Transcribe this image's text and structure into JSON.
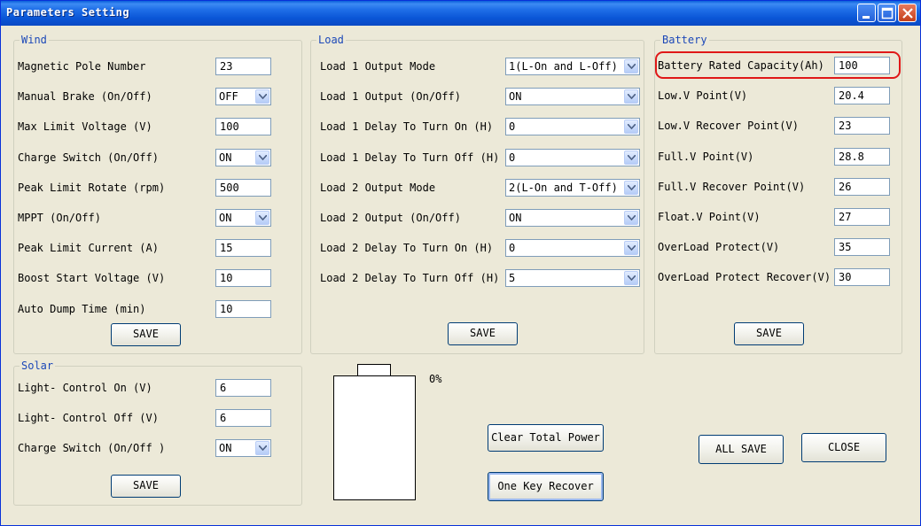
{
  "window": {
    "title": "Parameters Setting"
  },
  "wind": {
    "title": "Wind",
    "fields": [
      {
        "label": "Magnetic Pole Number",
        "value": "23",
        "type": "input"
      },
      {
        "label": "Manual Brake (On/Off)",
        "value": "OFF",
        "type": "select"
      },
      {
        "label": "Max Limit Voltage (V)",
        "value": "100",
        "type": "input"
      },
      {
        "label": "Charge Switch (On/Off)",
        "value": "ON",
        "type": "select"
      },
      {
        "label": "Peak Limit Rotate (rpm)",
        "value": "500",
        "type": "input"
      },
      {
        "label": "MPPT (On/Off)",
        "value": "ON",
        "type": "select"
      },
      {
        "label": "Peak Limit Current (A)",
        "value": "15",
        "type": "input"
      },
      {
        "label": "Boost Start Voltage (V)",
        "value": "10",
        "type": "input"
      },
      {
        "label": "Auto Dump Time (min)",
        "value": "10",
        "type": "input"
      }
    ],
    "save_label": "SAVE"
  },
  "load": {
    "title": "Load",
    "fields": [
      {
        "label": "Load 1 Output Mode",
        "value": "1(L-On and L-Off)"
      },
      {
        "label": "Load 1 Output (On/Off)",
        "value": "ON"
      },
      {
        "label": "Load 1 Delay To Turn On (H)",
        "value": "0"
      },
      {
        "label": "Load 1 Delay To Turn Off (H)",
        "value": "0"
      },
      {
        "label": "Load 2 Output Mode",
        "value": "2(L-On and T-Off)"
      },
      {
        "label": "Load 2 Output (On/Off)",
        "value": "ON"
      },
      {
        "label": "Load 2 Delay To Turn On (H)",
        "value": "0"
      },
      {
        "label": "Load 2 Delay To Turn Off (H)",
        "value": "5"
      }
    ],
    "save_label": "SAVE"
  },
  "battery": {
    "title": "Battery",
    "fields": [
      {
        "label": "Battery Rated Capacity(Ah)",
        "value": "100"
      },
      {
        "label": "Low.V Point(V)",
        "value": "20.4"
      },
      {
        "label": "Low.V Recover Point(V)",
        "value": "23"
      },
      {
        "label": "Full.V Point(V)",
        "value": "28.8"
      },
      {
        "label": "Full.V Recover Point(V)",
        "value": "26"
      },
      {
        "label": "Float.V Point(V)",
        "value": "27"
      },
      {
        "label": "OverLoad Protect(V)",
        "value": "35"
      },
      {
        "label": "OverLoad Protect Recover(V)",
        "value": "30"
      }
    ],
    "save_label": "SAVE"
  },
  "solar": {
    "title": "Solar",
    "fields": [
      {
        "label": "Light- Control On (V)",
        "value": "6",
        "type": "input"
      },
      {
        "label": "Light- Control Off (V)",
        "value": "6",
        "type": "input"
      },
      {
        "label": "Charge Switch (On/Off )",
        "value": "ON",
        "type": "select"
      }
    ],
    "save_label": "SAVE"
  },
  "battery_indicator": {
    "percent_label": "0%",
    "level": 0
  },
  "actions": {
    "clear_total_power": "Clear Total Power",
    "one_key_recover": "One Key Recover",
    "all_save": "ALL SAVE",
    "close": "CLOSE"
  },
  "colors": {
    "group_title": "#1c48b8",
    "highlight": "#e01818",
    "titlebar": "#0a55d6"
  }
}
